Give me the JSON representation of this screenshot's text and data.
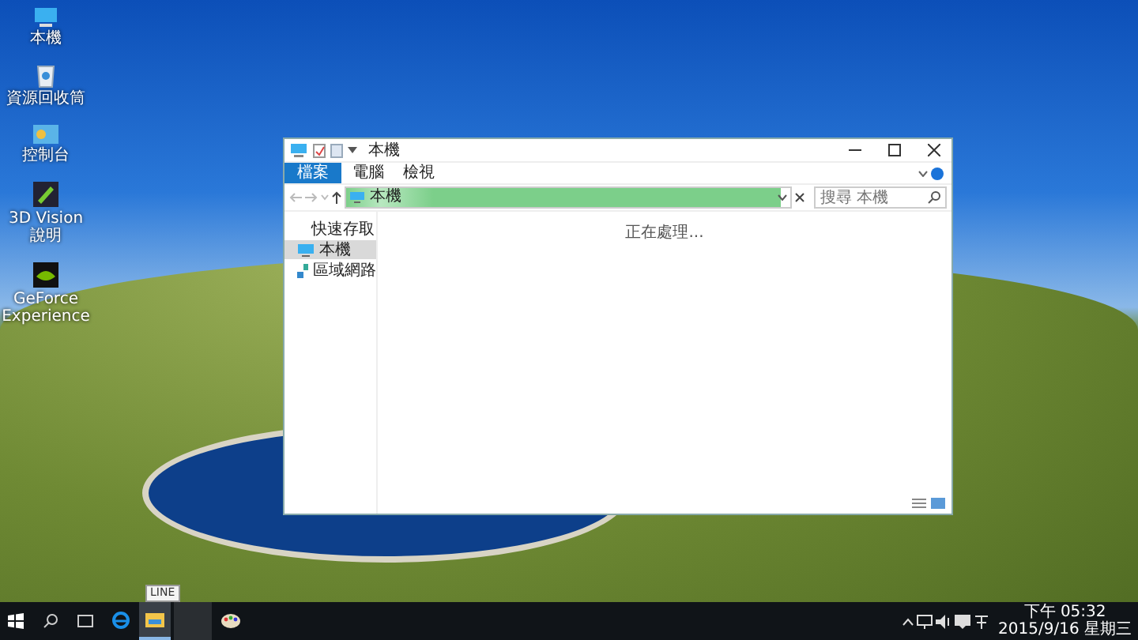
{
  "desktop_icons": [
    {
      "label": "本機",
      "kind": "pc"
    },
    {
      "label": "資源回收筒",
      "kind": "bin"
    },
    {
      "label": "控制台",
      "kind": "panel"
    },
    {
      "label": "3D Vision 說明",
      "kind": "vision"
    },
    {
      "label": "GeForce Experience",
      "kind": "geforce"
    }
  ],
  "window": {
    "title": "本機",
    "ribbon_tabs": [
      {
        "label": "檔案",
        "selected": true
      },
      {
        "label": "電腦",
        "selected": false
      },
      {
        "label": "檢視",
        "selected": false
      }
    ],
    "address": {
      "text": "本機",
      "level": 0.98
    },
    "search": {
      "placeholder": "搜尋 本機"
    },
    "nav": [
      {
        "label": "快速存取",
        "kind": "header",
        "selected": false
      },
      {
        "label": "本機",
        "kind": "pc",
        "selected": true
      },
      {
        "label": "區域網路",
        "kind": "network",
        "selected": false
      }
    ],
    "status": "正在處理..."
  },
  "taskbar": {
    "tooltip": "LINE",
    "apps": [
      {
        "kind": "edge",
        "selected": false
      },
      {
        "kind": "explorer",
        "selected": true
      },
      {
        "kind": "paint",
        "selected": false
      }
    ],
    "time": "下午 05:32",
    "date": "2015/9/16 星期三"
  }
}
